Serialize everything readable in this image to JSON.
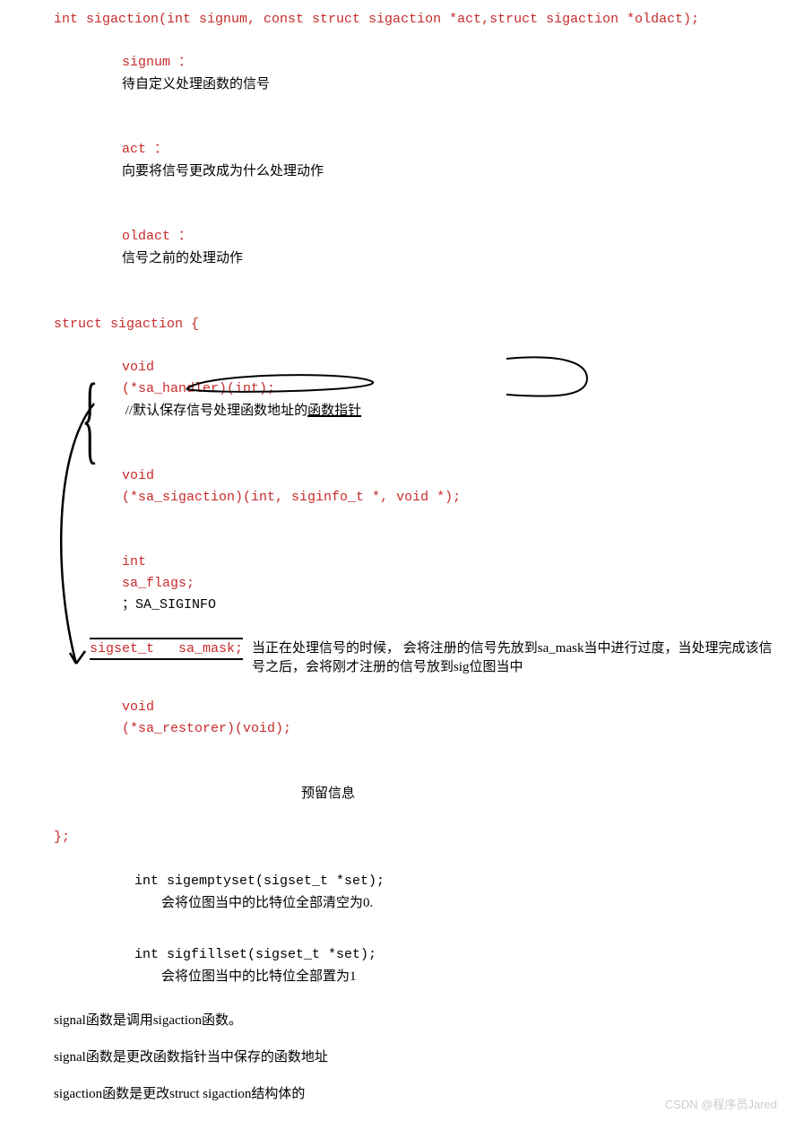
{
  "func_sig": {
    "declaration": "int sigaction(int signum, const struct sigaction *act,struct sigaction *oldact);",
    "param1_label": "signum ：",
    "param1_desc": "待自定义处理函数的信号",
    "param2_label": "act ：",
    "param2_desc": "向要将信号更改成为什么处理动作",
    "param3_label": "oldact ：",
    "param3_desc": "信号之前的处理动作"
  },
  "struct": {
    "open": "struct sigaction {",
    "member1_type": "void",
    "member1_decl": "(*sa_handler)(int);",
    "member1_comment": "//默认保存信号处理函数地址的函数指针",
    "member2_type": "void",
    "member2_decl": "(*sa_sigaction)(int, siginfo_t *, void *);",
    "member3_type": "int",
    "member3_name": "sa_flags;",
    "member3_value": "；SA_SIGINFO",
    "member4_type": "sigset_t",
    "member4_name": "sa_mask;",
    "member4_desc": "当正在处理信号的时候， 会将注册的信号先放到sa_mask当中进行过度，当处理完成该信号之后，会将刚才注册的信号放到sig位图当中",
    "member5_type": "void",
    "member5_decl": "(*sa_restorer)(void);",
    "member5_desc": "预留信息",
    "close": "};"
  },
  "related": {
    "func1_sig": "int sigemptyset(sigset_t *set);",
    "func1_desc": "会将位图当中的比特位全部清空为0.",
    "func2_sig": "int sigfillset(sigset_t *set);",
    "func2_desc": "会将位图当中的比特位全部置为1"
  },
  "notes": {
    "n1": "signal函数是调用sigaction函数。",
    "n2": "signal函数是更改函数指针当中保存的函数地址",
    "n3": "sigaction函数是更改struct sigaction结构体的"
  },
  "watermark": "CSDN @程序员Jared"
}
